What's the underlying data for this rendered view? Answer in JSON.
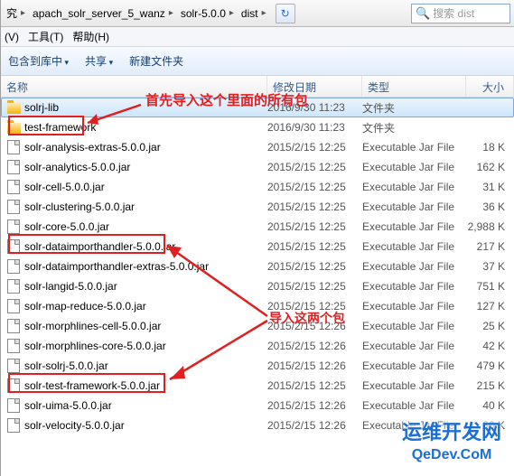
{
  "address": {
    "p1": "究",
    "p2": "apach_solr_server_5_wanz",
    "p3": "solr-5.0.0",
    "p4": "dist"
  },
  "search": {
    "placeholder": "搜索 dist"
  },
  "menu": {
    "m1": "(V)",
    "m2": "工具(T)",
    "m3": "帮助(H)"
  },
  "toolbar": {
    "t1": "包含到库中",
    "t2": "共享",
    "t3": "新建文件夹"
  },
  "cols": {
    "c1": "名称",
    "c2": "修改日期",
    "c3": "类型",
    "c4": "大小"
  },
  "files": [
    {
      "icon": "folder",
      "name": "solrj-lib",
      "date": "2016/9/30 11:23",
      "type": "文件夹",
      "size": ""
    },
    {
      "icon": "folder",
      "name": "test-framework",
      "date": "2016/9/30 11:23",
      "type": "文件夹",
      "size": ""
    },
    {
      "icon": "jar",
      "name": "solr-analysis-extras-5.0.0.jar",
      "date": "2015/2/15 12:25",
      "type": "Executable Jar File",
      "size": "18 K"
    },
    {
      "icon": "jar",
      "name": "solr-analytics-5.0.0.jar",
      "date": "2015/2/15 12:25",
      "type": "Executable Jar File",
      "size": "162 K"
    },
    {
      "icon": "jar",
      "name": "solr-cell-5.0.0.jar",
      "date": "2015/2/15 12:25",
      "type": "Executable Jar File",
      "size": "31 K"
    },
    {
      "icon": "jar",
      "name": "solr-clustering-5.0.0.jar",
      "date": "2015/2/15 12:25",
      "type": "Executable Jar File",
      "size": "36 K"
    },
    {
      "icon": "jar",
      "name": "solr-core-5.0.0.jar",
      "date": "2015/2/15 12:25",
      "type": "Executable Jar File",
      "size": "2,988 K"
    },
    {
      "icon": "jar",
      "name": "solr-dataimporthandler-5.0.0.jar",
      "date": "2015/2/15 12:25",
      "type": "Executable Jar File",
      "size": "217 K"
    },
    {
      "icon": "jar",
      "name": "solr-dataimporthandler-extras-5.0.0.jar",
      "date": "2015/2/15 12:25",
      "type": "Executable Jar File",
      "size": "37 K"
    },
    {
      "icon": "jar",
      "name": "solr-langid-5.0.0.jar",
      "date": "2015/2/15 12:25",
      "type": "Executable Jar File",
      "size": "751 K"
    },
    {
      "icon": "jar",
      "name": "solr-map-reduce-5.0.0.jar",
      "date": "2015/2/15 12:25",
      "type": "Executable Jar File",
      "size": "127 K"
    },
    {
      "icon": "jar",
      "name": "solr-morphlines-cell-5.0.0.jar",
      "date": "2015/2/15 12:26",
      "type": "Executable Jar File",
      "size": "25 K"
    },
    {
      "icon": "jar",
      "name": "solr-morphlines-core-5.0.0.jar",
      "date": "2015/2/15 12:26",
      "type": "Executable Jar File",
      "size": "42 K"
    },
    {
      "icon": "jar",
      "name": "solr-solrj-5.0.0.jar",
      "date": "2015/2/15 12:26",
      "type": "Executable Jar File",
      "size": "479 K"
    },
    {
      "icon": "jar",
      "name": "solr-test-framework-5.0.0.jar",
      "date": "2015/2/15 12:25",
      "type": "Executable Jar File",
      "size": "215 K"
    },
    {
      "icon": "jar",
      "name": "solr-uima-5.0.0.jar",
      "date": "2015/2/15 12:26",
      "type": "Executable Jar File",
      "size": "40 K"
    },
    {
      "icon": "jar",
      "name": "solr-velocity-5.0.0.jar",
      "date": "2015/2/15 12:26",
      "type": "Executable Jar File",
      "size": "30 K"
    }
  ],
  "anno": {
    "a1": "首先导入这个里面的所有包",
    "a2": "导入这两个包"
  },
  "wm": {
    "t1": "运维开发网",
    "t2": "QeDev.CoM"
  }
}
